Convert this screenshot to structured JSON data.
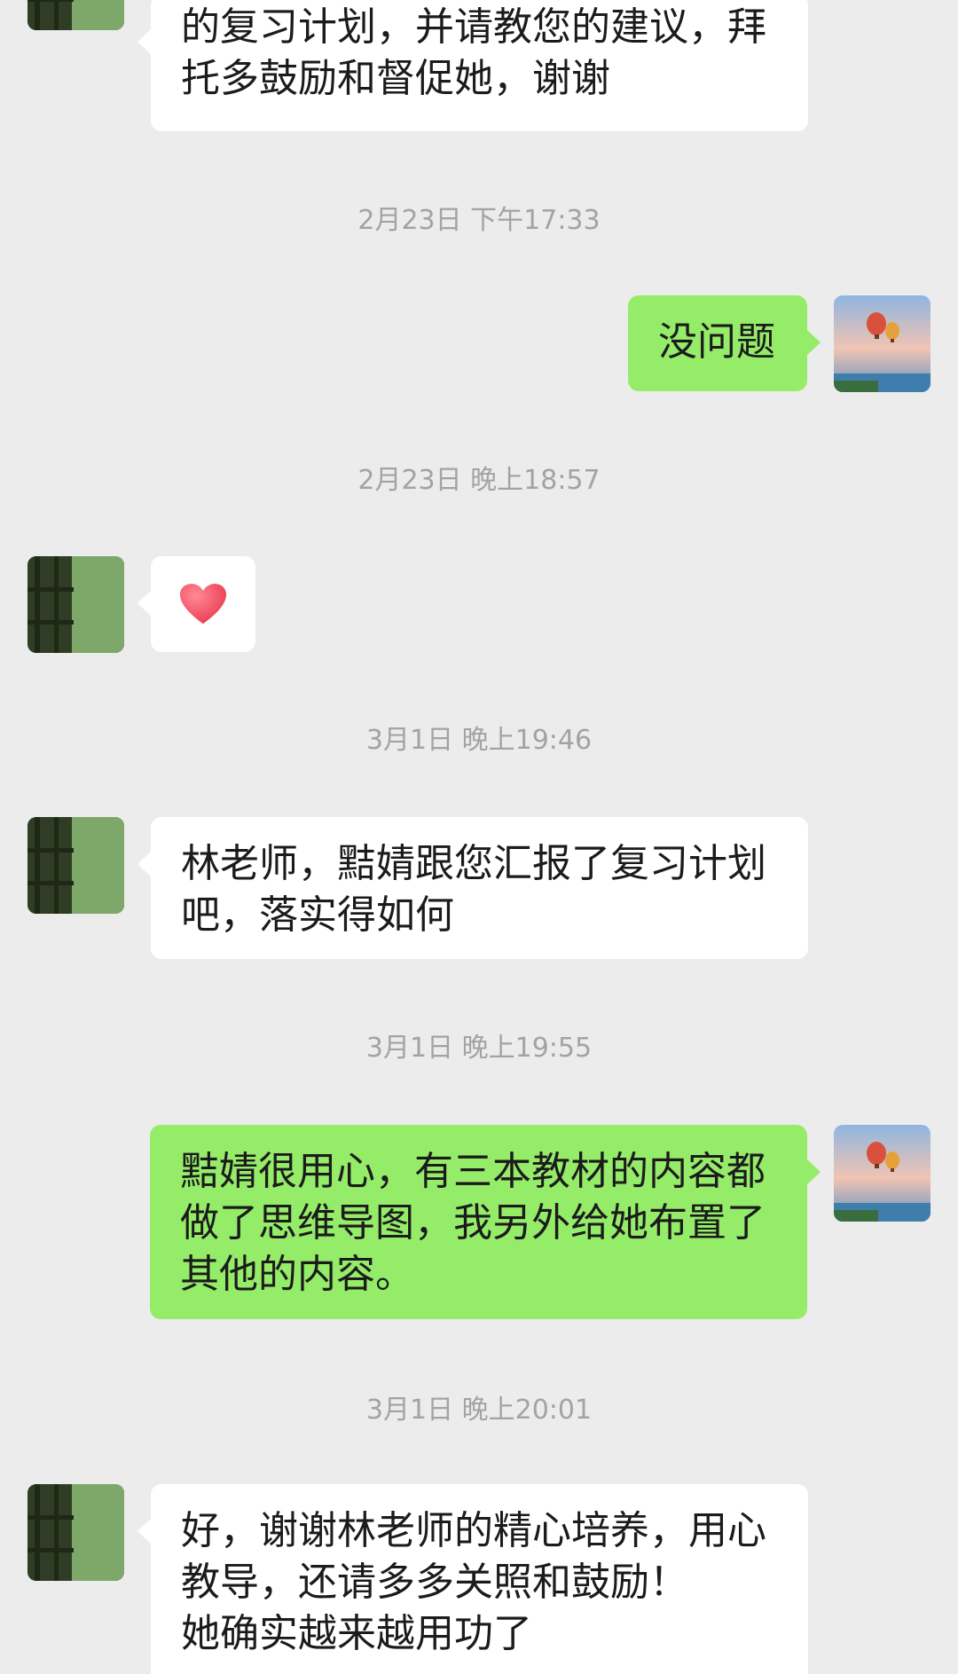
{
  "colors": {
    "background": "#ececec",
    "bubble_incoming": "#ffffff",
    "bubble_outgoing": "#95ec69",
    "timestamp_text": "#a3a3a3",
    "heart": "#f2596c"
  },
  "messages": [
    {
      "direction": "incoming",
      "avatar": "green-window-avatar",
      "text": "的复习计划，并请教您的建议，拜托多鼓励和督促她，谢谢"
    },
    {
      "timestamp": "2月23日 下午17:33"
    },
    {
      "direction": "outgoing",
      "avatar": "hot-air-balloon-avatar",
      "text": "没问题"
    },
    {
      "timestamp": "2月23日 晚上18:57"
    },
    {
      "direction": "incoming",
      "avatar": "green-window-avatar",
      "sticker": "heart-icon"
    },
    {
      "timestamp": "3月1日 晚上19:46"
    },
    {
      "direction": "incoming",
      "avatar": "green-window-avatar",
      "text": "林老师，黠婧跟您汇报了复习计划吧，落实得如何"
    },
    {
      "timestamp": "3月1日 晚上19:55"
    },
    {
      "direction": "outgoing",
      "avatar": "hot-air-balloon-avatar",
      "text": "黠婧很用心，有三本教材的内容都做了思维导图，我另外给她布置了其他的内容。"
    },
    {
      "timestamp": "3月1日 晚上20:01"
    },
    {
      "direction": "incoming",
      "avatar": "green-window-avatar",
      "text": "好，谢谢林老师的精心培养，用心教导，还请多多关照和鼓励！\n她确实越来越用功了"
    }
  ]
}
